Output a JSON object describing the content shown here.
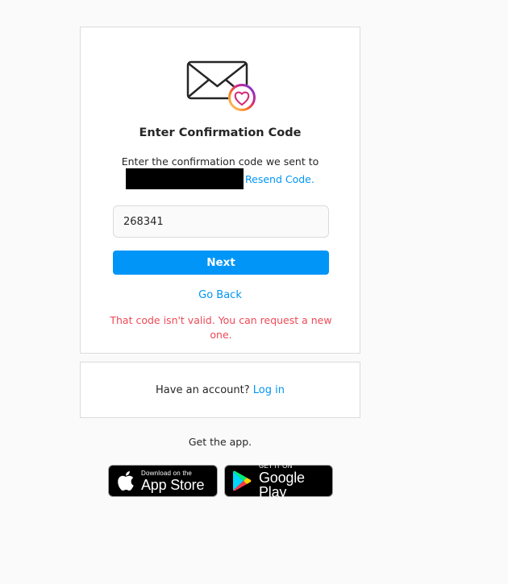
{
  "confirmation": {
    "heading": "Enter Confirmation Code",
    "instructions": "Enter the confirmation code we sent to",
    "resend_link": "Resend Code.",
    "code_value": "268341",
    "next_button": "Next",
    "go_back_link": "Go Back",
    "error_message": "That code isn't valid. You can request a new one."
  },
  "login_box": {
    "prompt": "Have an account?",
    "login_link": "Log in"
  },
  "get_app": {
    "label": "Get the app.",
    "app_store": {
      "small": "Download on the",
      "big": "App Store"
    },
    "google_play": {
      "small": "GET IT ON",
      "big": "Google Play"
    }
  },
  "icons": {
    "illustration": "mail-heart-icon",
    "apple": "apple-icon",
    "google_play": "google-play-icon"
  },
  "colors": {
    "accent": "#0095f6",
    "error": "#ed4956",
    "border": "#dbdbdb",
    "background": "#fafafa"
  }
}
